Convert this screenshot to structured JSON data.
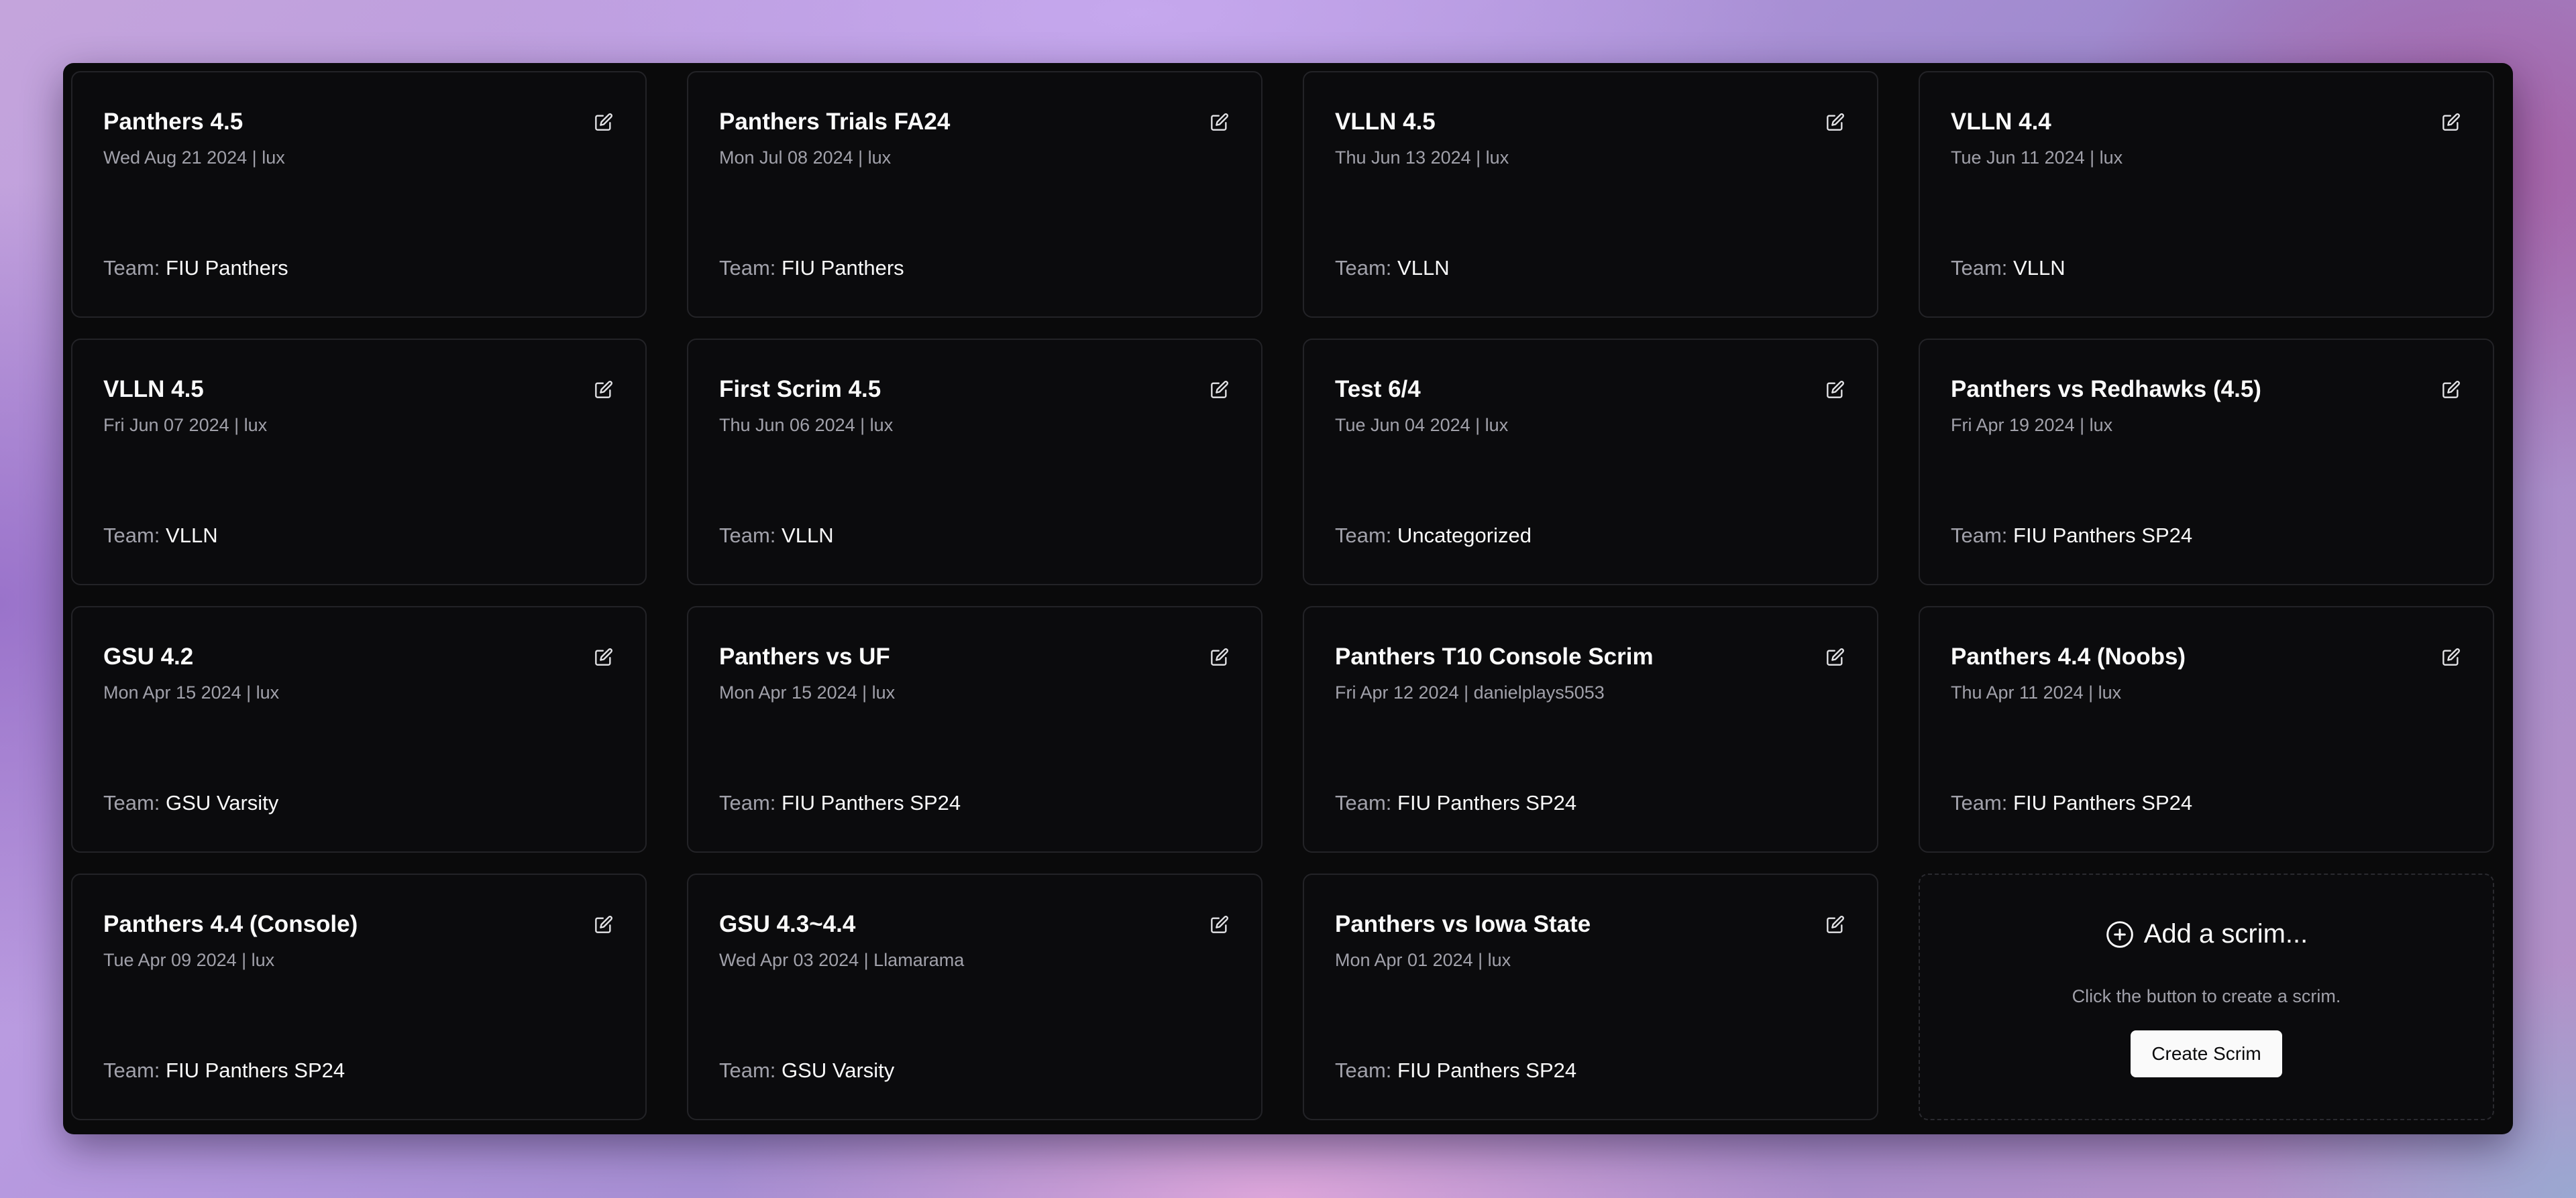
{
  "team_label": "Team:",
  "scrims": [
    {
      "title": "Panthers 4.5",
      "meta": "Wed Aug 21 2024 | lux",
      "team": "FIU Panthers"
    },
    {
      "title": "Panthers Trials FA24",
      "meta": "Mon Jul 08 2024 | lux",
      "team": "FIU Panthers"
    },
    {
      "title": "VLLN 4.5",
      "meta": "Thu Jun 13 2024 | lux",
      "team": "VLLN"
    },
    {
      "title": "VLLN 4.4",
      "meta": "Tue Jun 11 2024 | lux",
      "team": "VLLN"
    },
    {
      "title": "VLLN 4.5",
      "meta": "Fri Jun 07 2024 | lux",
      "team": "VLLN"
    },
    {
      "title": "First Scrim 4.5",
      "meta": "Thu Jun 06 2024 | lux",
      "team": "VLLN"
    },
    {
      "title": "Test 6/4",
      "meta": "Tue Jun 04 2024 | lux",
      "team": "Uncategorized"
    },
    {
      "title": "Panthers vs Redhawks (4.5)",
      "meta": "Fri Apr 19 2024 | lux",
      "team": "FIU Panthers SP24"
    },
    {
      "title": "GSU 4.2",
      "meta": "Mon Apr 15 2024 | lux",
      "team": "GSU Varsity"
    },
    {
      "title": "Panthers vs UF",
      "meta": "Mon Apr 15 2024 | lux",
      "team": "FIU Panthers SP24"
    },
    {
      "title": "Panthers T10 Console Scrim",
      "meta": "Fri Apr 12 2024 | danielplays5053",
      "team": "FIU Panthers SP24"
    },
    {
      "title": "Panthers 4.4 (Noobs)",
      "meta": "Thu Apr 11 2024 | lux",
      "team": "FIU Panthers SP24"
    },
    {
      "title": "Panthers 4.4 (Console)",
      "meta": "Tue Apr 09 2024 | lux",
      "team": "FIU Panthers SP24"
    },
    {
      "title": "GSU 4.3~4.4",
      "meta": "Wed Apr 03 2024 | Llamarama",
      "team": "GSU Varsity"
    },
    {
      "title": "Panthers vs Iowa State",
      "meta": "Mon Apr 01 2024 | lux",
      "team": "FIU Panthers SP24"
    }
  ],
  "add_card": {
    "title": "Add a scrim...",
    "description": "Click the button to create a scrim.",
    "button_label": "Create Scrim"
  },
  "icons": {
    "edit": "edit-icon",
    "add": "plus-circle-icon"
  }
}
